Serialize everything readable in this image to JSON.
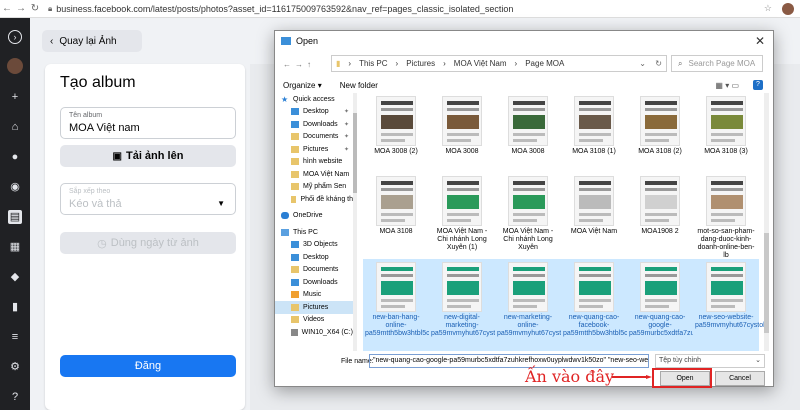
{
  "browser": {
    "url": "business.facebook.com/latest/posts/photos?asset_id=116175009763592&nav_ref=pages_classic_isolated_section"
  },
  "facebook": {
    "back_label": "Quay lại Ảnh",
    "panel_title": "Tạo album",
    "album_name_label": "Tên album",
    "album_name_value": "MOA Việt nam",
    "upload_label": "Tải ảnh lên",
    "sort_label": "Sắp xếp theo",
    "sort_value": "Kéo và thả",
    "date_button": "Dùng ngày từ ảnh",
    "post_button": "Đăng"
  },
  "dialog": {
    "title": "Open",
    "path": [
      "This PC",
      "Pictures",
      "MOA Việt Nam",
      "Page MOA"
    ],
    "search_placeholder": "Search Page MOA",
    "organize": "Organize",
    "new_folder": "New folder",
    "nav_items": [
      {
        "label": "Quick access",
        "icon": "star",
        "pin": false
      },
      {
        "label": "Desktop",
        "icon": "blue",
        "pin": true
      },
      {
        "label": "Downloads",
        "icon": "blue",
        "pin": true
      },
      {
        "label": "Documents",
        "icon": "fold",
        "pin": true
      },
      {
        "label": "Pictures",
        "icon": "fold",
        "pin": true
      },
      {
        "label": "hình website",
        "icon": "fold",
        "pin": false
      },
      {
        "label": "MOA Việt Nam",
        "icon": "fold",
        "pin": false
      },
      {
        "label": "Mỹ phẩm Sen",
        "icon": "fold",
        "pin": false
      },
      {
        "label": "Phối đề kháng th",
        "icon": "fold",
        "pin": false
      },
      {
        "label": "OneDrive",
        "icon": "drive",
        "pin": false
      },
      {
        "label": "This PC",
        "icon": "pc",
        "pin": false
      },
      {
        "label": "3D Objects",
        "icon": "blue",
        "pin": false
      },
      {
        "label": "Desktop",
        "icon": "blue",
        "pin": false
      },
      {
        "label": "Documents",
        "icon": "fold",
        "pin": false
      },
      {
        "label": "Downloads",
        "icon": "blue",
        "pin": false
      },
      {
        "label": "Music",
        "icon": "music",
        "pin": false
      },
      {
        "label": "Pictures",
        "icon": "fold",
        "pin": false,
        "selected": true
      },
      {
        "label": "Videos",
        "icon": "fold",
        "pin": false
      },
      {
        "label": "WIN10_X64 (C:)",
        "icon": "disk",
        "pin": false
      }
    ],
    "files": [
      {
        "name": "MOA 3008 (2)",
        "color": "#5a4a3a"
      },
      {
        "name": "MOA 3008",
        "color": "#7a5a3a"
      },
      {
        "name": "MOA 3008",
        "color": "#3a6a3a"
      },
      {
        "name": "MOA 3108 (1)",
        "color": "#6a5a4a"
      },
      {
        "name": "MOA 3108 (2)",
        "color": "#8a6a3a"
      },
      {
        "name": "MOA 3108 (3)",
        "color": "#7a8a3a"
      },
      {
        "name": "MOA 3108",
        "color": "#aaa090"
      },
      {
        "name": "MOA Việt Nam - Chi nhánh Long Xuyên (1)",
        "color": "#2a9a5a"
      },
      {
        "name": "MOA Việt Nam - Chi nhánh Long Xuyên",
        "color": "#2a9a5a"
      },
      {
        "name": "MOA Việt Nam",
        "color": "#bbbbbb"
      },
      {
        "name": "MOA1908 2",
        "color": "#d0d0d0"
      },
      {
        "name": "mot-so-san-pham-dang-duoc-kinh-doanh-online-ben-lb",
        "color": "#b09070"
      },
      {
        "name": "new-ban-hang-online-pa59mtth5bw3htbl5c2y6wo13k0m9lvk9d...",
        "color": "#1aa07a",
        "selected": true
      },
      {
        "name": "new-digital-marketing-pa59mvmyhut67cystobmewki65afk584...",
        "color": "#1aa07a",
        "selected": true
      },
      {
        "name": "new-marketing-online-pa59mvmyhut67cystobmewki65afk58...",
        "color": "#1aa07a",
        "selected": true
      },
      {
        "name": "new-quang-cao-facebook-pa59mtth5bw3htbl5c2y6wo13k0m9lvk...",
        "color": "#1aa07a",
        "selected": true
      },
      {
        "name": "new-quang-cao-google-pa59murbc5xdtfa7zuhkrefhoxw0uyplwd...",
        "color": "#1aa07a",
        "selected": true
      },
      {
        "name": "new-seo-website-pa59mvmyhut67cystobmewki65afk584kv4f...",
        "color": "#1aa07a",
        "selected": true
      }
    ],
    "file_name_label": "File name:",
    "file_name_value": "\"new-quang-cao-google-pa59murbc5xdtfa7zuhkrefhoxw0uyplwdwv1k50zo\" \"new-seo-website-",
    "file_type": "Tệp tùy chỉnh",
    "open_label": "Open",
    "cancel_label": "Cancel"
  },
  "annotation": {
    "text": "Ấn vào đây",
    "color": "#e02424"
  }
}
